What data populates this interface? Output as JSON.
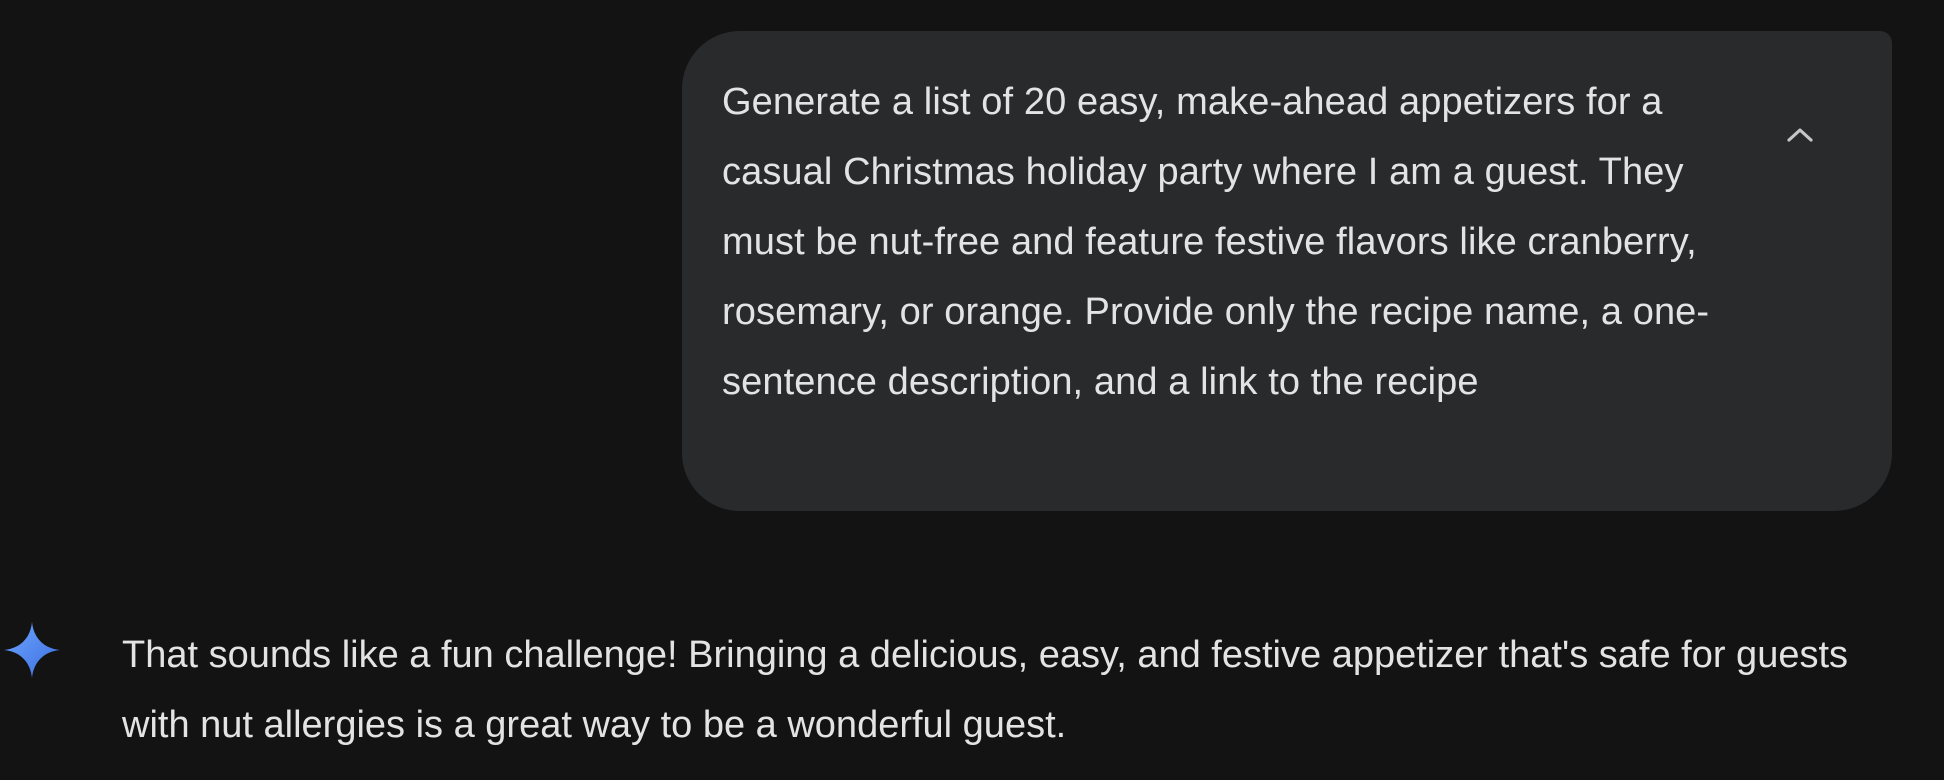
{
  "conversation": {
    "user_prompt": {
      "text": "Generate a list of 20 easy, make-ahead appetizers for a casual Christmas holiday party where I am a guest. They must be nut-free and feature festive flavors like cranberry, rosemary, or orange. Provide only the recipe name, a one-sentence description, and a link to the recipe",
      "toggle_icon": "chevron-up-icon"
    },
    "model_response": {
      "avatar_icon": "gemini-spark-icon",
      "text": "That sounds like a fun challenge! Bringing a delicious, easy, and festive appetizer that's safe for guests with nut allergies is a great way to be a wonderful guest."
    }
  },
  "colors": {
    "background": "#131314",
    "bubble": "#282a2c",
    "text": "#e3e3e3",
    "spark_start": "#4f8ef7",
    "spark_end": "#3b6fd8"
  }
}
